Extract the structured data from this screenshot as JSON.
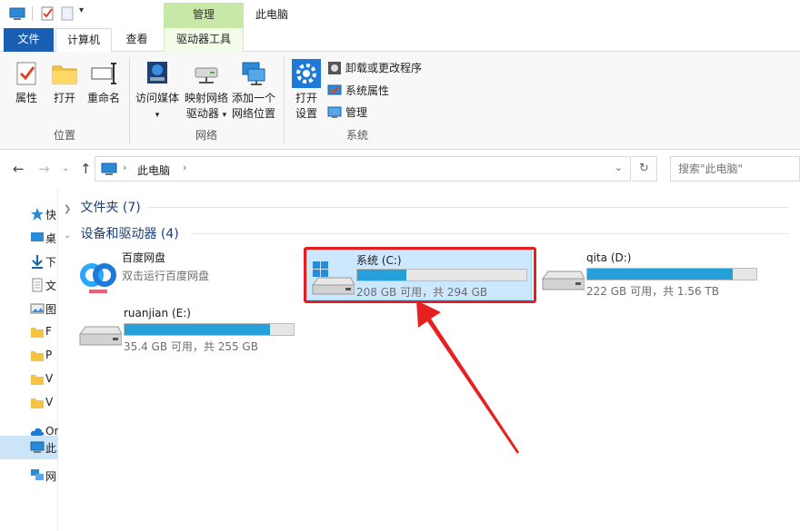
{
  "window": {
    "title": "此电脑",
    "context_tab": "管理"
  },
  "tabs": {
    "file": "文件",
    "computer": "计算机",
    "view": "查看",
    "drive_tools": "驱动器工具"
  },
  "ribbon": {
    "location": {
      "name": "位置",
      "properties": "属性",
      "open": "打开",
      "rename": "重命名"
    },
    "network": {
      "name": "网络",
      "access_media": "访问媒体",
      "map_drive_l1": "映射网络",
      "map_drive_l2": "驱动器",
      "add_location_l1": "添加一个",
      "add_location_l2": "网络位置"
    },
    "system": {
      "name": "系统",
      "open_settings_l1": "打开",
      "open_settings_l2": "设置",
      "uninstall": "卸载或更改程序",
      "system_properties": "系统属性",
      "manage": "管理"
    }
  },
  "address": {
    "path": "此电脑",
    "search_placeholder": "搜索\"此电脑\""
  },
  "navpane": {
    "items": [
      {
        "label": "快"
      },
      {
        "label": "桌"
      },
      {
        "label": "下"
      },
      {
        "label": "文"
      },
      {
        "label": "图"
      },
      {
        "label": "F"
      },
      {
        "label": "P"
      },
      {
        "label": "V"
      },
      {
        "label": "V"
      },
      {
        "label": "Or"
      },
      {
        "label": "此"
      },
      {
        "label": "网"
      }
    ]
  },
  "sections": {
    "folders": "文件夹 (7)",
    "devices": "设备和驱动器 (4)"
  },
  "drives": [
    {
      "name": "百度网盘",
      "sub": "双击运行百度网盘",
      "has_bar": false
    },
    {
      "name": "系统 (C:)",
      "sub": "208 GB 可用，共 294 GB",
      "used_fraction": 0.29,
      "has_bar": true
    },
    {
      "name": "qita (D:)",
      "sub": "222 GB 可用，共 1.56 TB",
      "used_fraction": 0.86,
      "has_bar": true
    },
    {
      "name": "ruanjian (E:)",
      "sub": "35.4 GB 可用，共 255 GB",
      "used_fraction": 0.86,
      "has_bar": true
    }
  ],
  "colors": {
    "accent": "#1a5fb4",
    "bar_fill": "#26a0da",
    "highlight": "#e02020",
    "context_tab": "#c8e8a8"
  }
}
